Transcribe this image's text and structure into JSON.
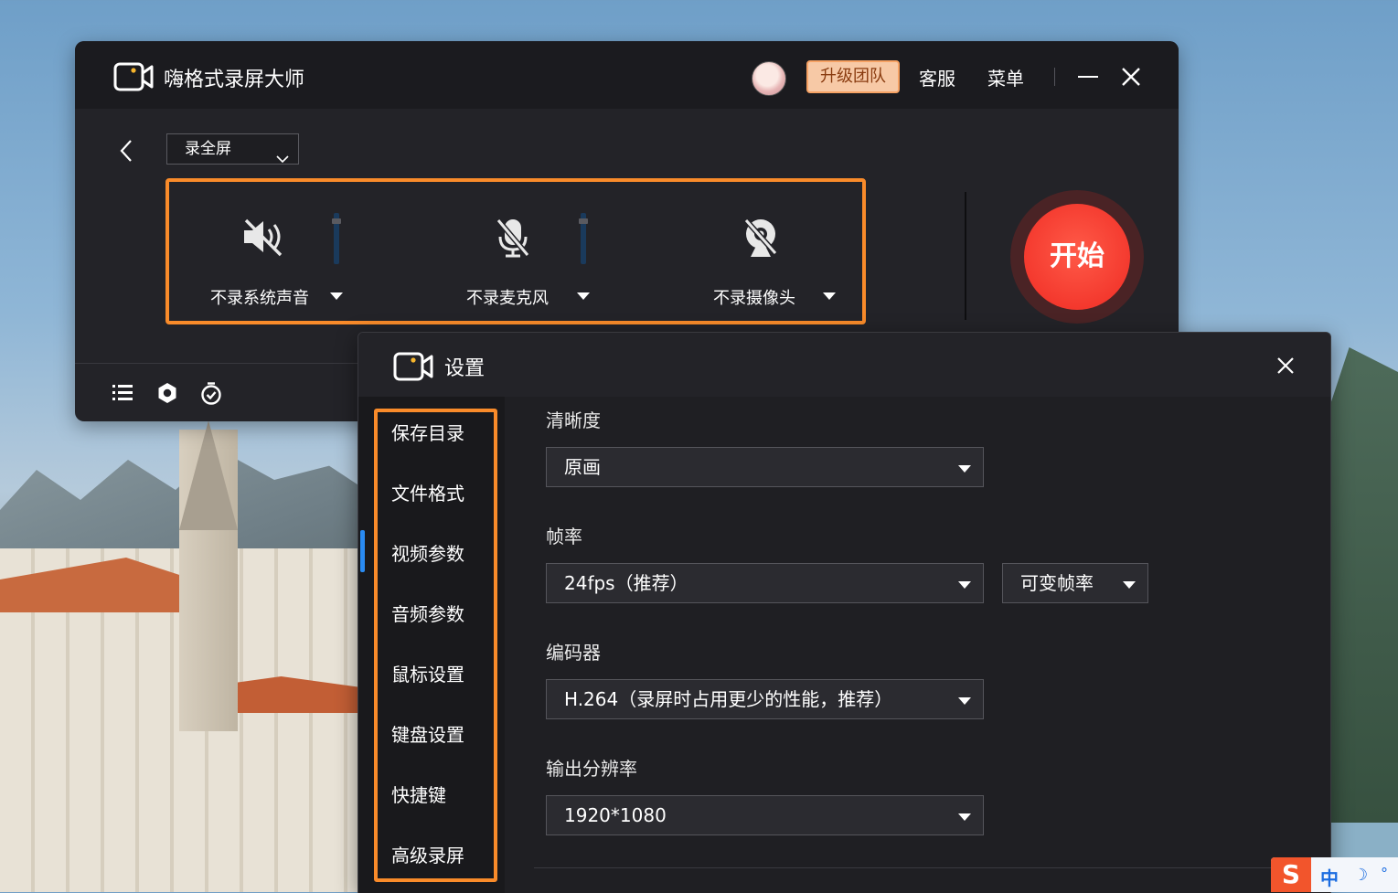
{
  "app": {
    "title": "嗨格式录屏大师",
    "upgrade_label": "升级团队",
    "customer_service": "客服",
    "menu": "菜单",
    "mode_select": "录全屏",
    "start_label": "开始"
  },
  "controls": [
    {
      "label": "不录系统声音",
      "icon": "speaker-muted-icon"
    },
    {
      "label": "不录麦克风",
      "icon": "mic-muted-icon"
    },
    {
      "label": "不录摄像头",
      "icon": "camera-off-icon"
    }
  ],
  "settings": {
    "title": "设置",
    "nav": [
      "保存目录",
      "文件格式",
      "视频参数",
      "音频参数",
      "鼠标设置",
      "键盘设置",
      "快捷键",
      "高级录屏"
    ],
    "active_nav": "视频参数",
    "fields": {
      "clarity_label": "清晰度",
      "clarity_value": "原画",
      "framerate_label": "帧率",
      "framerate_value": "24fps（推荐）",
      "framerate_mode": "可变帧率",
      "encoder_label": "编码器",
      "encoder_value": "H.264（录屏时占用更少的性能，推荐）",
      "resolution_label": "输出分辨率",
      "resolution_value": "1920*1080"
    }
  },
  "ime": {
    "logo": "S",
    "mode": "中"
  },
  "colors": {
    "highlight": "#f98b2a",
    "start": "#f2342a",
    "accent_blue": "#2a8bf2",
    "upgrade_bg": "#f7c9a6"
  }
}
